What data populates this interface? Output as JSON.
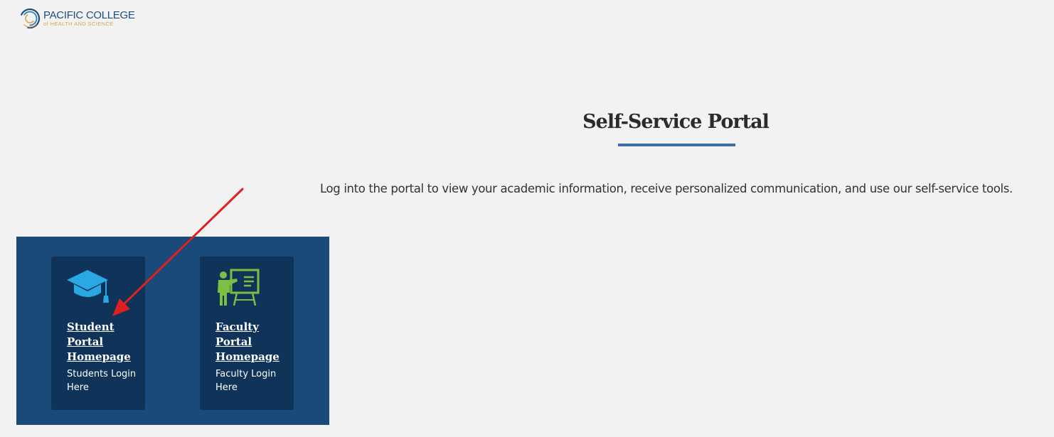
{
  "logo": {
    "line1": "PACIFIC COLLEGE",
    "line2": "of HEALTH AND SCIENCE",
    "icon": "college-logo-icon"
  },
  "header": {
    "title": "Self-Service Portal",
    "intro": "Log into the portal to view your academic information, receive personalized communication, and use our self-service tools."
  },
  "cards": [
    {
      "icon": "graduation-cap-icon",
      "link_label": "Student Portal Homepage",
      "description": "Students Login Here"
    },
    {
      "icon": "teacher-board-icon",
      "link_label": "Faculty Portal Homepage",
      "description": "Faculty Login Here"
    }
  ],
  "colors": {
    "background": "#f2f2f2",
    "panel": "#1a4a7a",
    "card": "#0f3359",
    "accent_blue": "#3a6ea5",
    "student_icon": "#2aa8e4",
    "faculty_icon": "#7ac143",
    "annotation_arrow": "#e02020"
  }
}
